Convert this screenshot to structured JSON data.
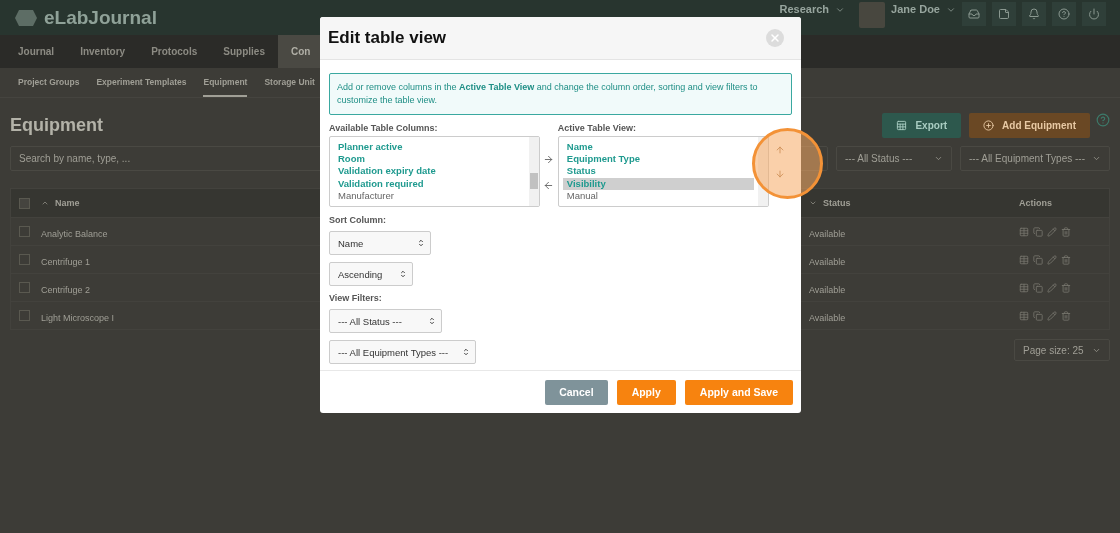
{
  "app": {
    "logo": "eLabJournal",
    "org": "Research",
    "user": "Jane Doe"
  },
  "nav": [
    {
      "label": "Journal",
      "selected": false
    },
    {
      "label": "Inventory",
      "selected": false
    },
    {
      "label": "Protocols",
      "selected": false
    },
    {
      "label": "Supplies",
      "selected": false
    },
    {
      "label": "Con",
      "selected": true
    }
  ],
  "subnav": [
    {
      "label": "Project Groups",
      "selected": false
    },
    {
      "label": "Experiment Templates",
      "selected": false
    },
    {
      "label": "Equipment",
      "selected": true
    },
    {
      "label": "Storage Unit",
      "selected": false
    }
  ],
  "page": {
    "title": "Equipment",
    "export": "Export",
    "add": "Add Equipment",
    "search_placeholder": "Search by name, type, ...",
    "filters": [
      "--- All Status ---",
      "--- All Equipment Types ---"
    ],
    "page_size": "Page size: 25"
  },
  "table": {
    "columns": [
      "Name",
      "Status",
      "Actions"
    ],
    "all_checked": false,
    "rows": [
      {
        "name": "Analytic Balance",
        "status": "Available",
        "checked": false
      },
      {
        "name": "Centrifuge 1",
        "status": "Available",
        "checked": false
      },
      {
        "name": "Centrifuge 2",
        "status": "Available",
        "checked": false
      },
      {
        "name": "Light Microscope I",
        "status": "Available",
        "checked": false
      }
    ]
  },
  "dialog": {
    "title": "Edit table view",
    "info": "Add or remove columns in the **Active Table View** and change the column order, sorting and view filters to customize the table view.",
    "available_label": "Available Table Columns:",
    "available": [
      {
        "label": "Planner active",
        "emphasized": true,
        "selected": false
      },
      {
        "label": "Room",
        "emphasized": true,
        "selected": false
      },
      {
        "label": "Validation expiry date",
        "emphasized": true,
        "selected": false
      },
      {
        "label": "Validation required",
        "emphasized": true,
        "selected": false
      },
      {
        "label": "Manufacturer",
        "emphasized": false,
        "selected": false
      }
    ],
    "active_label": "Active Table View:",
    "active": [
      {
        "label": "Name",
        "emphasized": true,
        "selected": false
      },
      {
        "label": "Equipment Type",
        "emphasized": true,
        "selected": false
      },
      {
        "label": "Status",
        "emphasized": true,
        "selected": false
      },
      {
        "label": "Visibility",
        "emphasized": true,
        "selected": true
      },
      {
        "label": "Manual",
        "emphasized": false,
        "selected": false
      }
    ],
    "sort_label": "Sort Column:",
    "sort_column": "Name",
    "sort_order": "Ascending",
    "filters_label": "View Filters:",
    "filters": [
      "--- All Status ---",
      "--- All Equipment Types ---"
    ],
    "buttons": [
      {
        "label": "Cancel",
        "kind": "secondary"
      },
      {
        "label": "Apply",
        "kind": "primary"
      },
      {
        "label": "Apply and Save",
        "kind": "primary"
      }
    ]
  }
}
